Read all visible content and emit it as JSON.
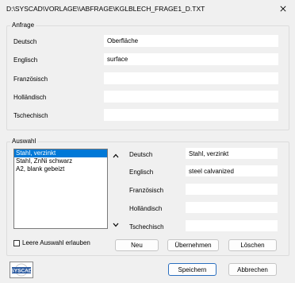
{
  "window": {
    "title": "D:\\SYSCAD\\VORLAGE\\\\ABFRAGE\\KGLBLECH_FRAGE1_D.TXT"
  },
  "anfrage": {
    "label": "Anfrage",
    "rows": [
      {
        "label": "Deutsch",
        "value": "Oberfläche"
      },
      {
        "label": "Englisch",
        "value": "surface"
      },
      {
        "label": "Französisch",
        "value": ""
      },
      {
        "label": "Holländisch",
        "value": ""
      },
      {
        "label": "Tschechisch",
        "value": ""
      }
    ]
  },
  "auswahl": {
    "label": "Auswahl",
    "list": [
      "Stahl, verzinkt",
      "Stahl, ZnNi schwarz",
      "A2, blank gebeizt"
    ],
    "selected_index": 0,
    "rows": [
      {
        "label": "Deutsch",
        "value": "Stahl, verzinkt"
      },
      {
        "label": "Englisch",
        "value": "steel calvanized"
      },
      {
        "label": "Französisch",
        "value": ""
      },
      {
        "label": "Holländisch",
        "value": ""
      },
      {
        "label": "Tschechisch",
        "value": ""
      }
    ],
    "checkbox_label": "Leere Auswahl erlauben",
    "checkbox_checked": false,
    "buttons": {
      "new": "Neu",
      "take": "Übernehmen",
      "delete": "Löschen"
    }
  },
  "footer": {
    "logo_text": "SYSCAD",
    "save": "Speichern",
    "cancel": "Abbrechen"
  }
}
